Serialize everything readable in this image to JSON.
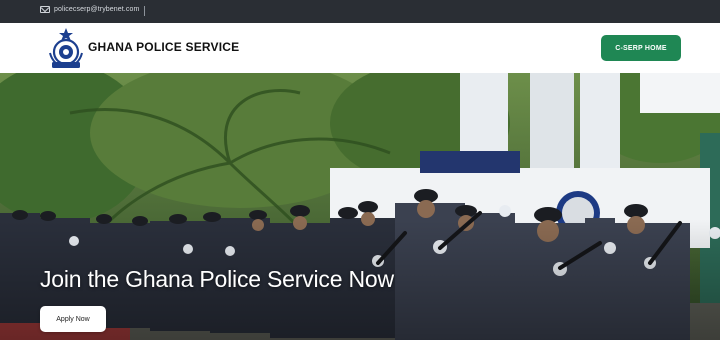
{
  "topbar": {
    "email": "policecserp@trybenet.com",
    "email_icon": "mail-icon"
  },
  "header": {
    "brand": "GHANA POLICE SERVICE",
    "logo_icon": "police-crest-icon",
    "cta_label": "C-SERP HOME"
  },
  "hero": {
    "title": "Join the Ghana Police Service Now",
    "apply_label": "Apply Now"
  },
  "colors": {
    "topbar": "#2a2e34",
    "accent": "#1f8754",
    "uniform": "#3b4150"
  }
}
